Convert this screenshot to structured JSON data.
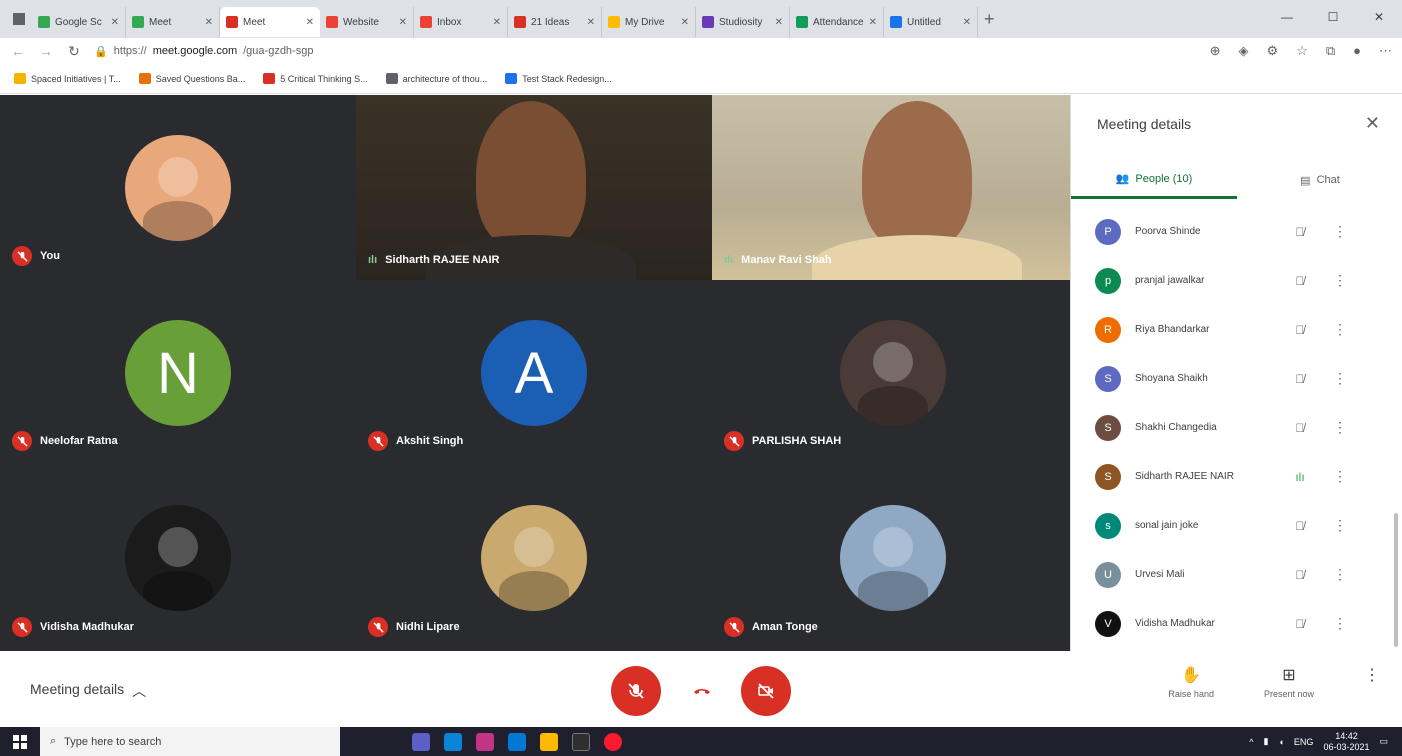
{
  "browser": {
    "tabs": [
      {
        "title": "Google Sc",
        "color": "#34a853"
      },
      {
        "title": "Meet",
        "color": "#34a853"
      },
      {
        "title": "Meet",
        "color": "#d93025",
        "active": true
      },
      {
        "title": "Website",
        "color": "#ea4335"
      },
      {
        "title": "Inbox",
        "color": "#ea4335"
      },
      {
        "title": "21 Ideas",
        "color": "#d93025"
      },
      {
        "title": "My Drive",
        "color": "#fbbc04"
      },
      {
        "title": "Studiosity",
        "color": "#673ab7"
      },
      {
        "title": "Attendance",
        "color": "#0f9d58"
      },
      {
        "title": "Untitled",
        "color": "#1a73e8"
      }
    ],
    "url_prefix": "https://",
    "url_host": "meet.google.com",
    "url_path": "/gua-gzdh-sgp",
    "bookmarks": [
      {
        "label": "Spaced Initiatives | T...",
        "color": "#f4b400"
      },
      {
        "label": "Saved Questions Ba...",
        "color": "#e8710a"
      },
      {
        "label": "5 Critical Thinking S...",
        "color": "#d93025"
      },
      {
        "label": "architecture of thou...",
        "color": "#5f6368"
      },
      {
        "label": "Test Stack Redesign...",
        "color": "#1a73e8"
      }
    ]
  },
  "meeting": {
    "tiles": [
      {
        "name": "You",
        "muted": true,
        "type": "photo",
        "bg": "#e8a87c"
      },
      {
        "name": "Sidharth RAJEE NAIR",
        "muted": false,
        "type": "video"
      },
      {
        "name": "Manav Ravi Shah",
        "muted": false,
        "type": "video"
      },
      {
        "name": "Neelofar Ratna",
        "muted": true,
        "type": "letter",
        "letter": "N",
        "bg": "#689f38"
      },
      {
        "name": "Akshit Singh",
        "muted": true,
        "type": "letter",
        "letter": "A",
        "bg": "#1a5fb4"
      },
      {
        "name": "PARLISHA SHAH",
        "muted": true,
        "type": "photo",
        "bg": "#4a3b36"
      },
      {
        "name": "Vidisha Madhukar",
        "muted": true,
        "type": "photo",
        "bg": "#1b1b1b"
      },
      {
        "name": "Nidhi Lipare",
        "muted": true,
        "type": "photo",
        "bg": "#c9a96e"
      },
      {
        "name": "Aman Tonge",
        "muted": true,
        "type": "photo",
        "bg": "#8fa9c4"
      }
    ]
  },
  "side_panel": {
    "title": "Meeting details",
    "tab_people": "People (10)",
    "tab_chat": "Chat",
    "people": [
      {
        "name": "Poorva Shinde",
        "initial": "P",
        "color": "#5c6bc0",
        "muted": true
      },
      {
        "name": "pranjal jawalkar",
        "initial": "p",
        "color": "#0d8a4f",
        "muted": true
      },
      {
        "name": "Riya Bhandarkar",
        "initial": "R",
        "color": "#ef6c00",
        "muted": true
      },
      {
        "name": "Shoyana Shaikh",
        "initial": "S",
        "color": "#5c6bc0",
        "muted": true
      },
      {
        "name": "Shakhi Changedia",
        "initial": "S",
        "color": "#6d4c41",
        "muted": true
      },
      {
        "name": "Sidharth RAJEE NAIR",
        "initial": "S",
        "color": "#8d5524",
        "muted": false
      },
      {
        "name": "sonal jain joke",
        "initial": "s",
        "color": "#00897b",
        "muted": true
      },
      {
        "name": "Urvesi Mali",
        "initial": "U",
        "color": "#78909c",
        "muted": true
      },
      {
        "name": "Vidisha Madhukar",
        "initial": "V",
        "color": "#111111",
        "muted": true
      }
    ]
  },
  "controls": {
    "meeting_details": "Meeting details",
    "raise_hand": "Raise hand",
    "present_now": "Present now"
  },
  "taskbar": {
    "search_placeholder": "Type here to search",
    "lang": "ENG",
    "time": "14:42",
    "date": "06-03-2021"
  }
}
